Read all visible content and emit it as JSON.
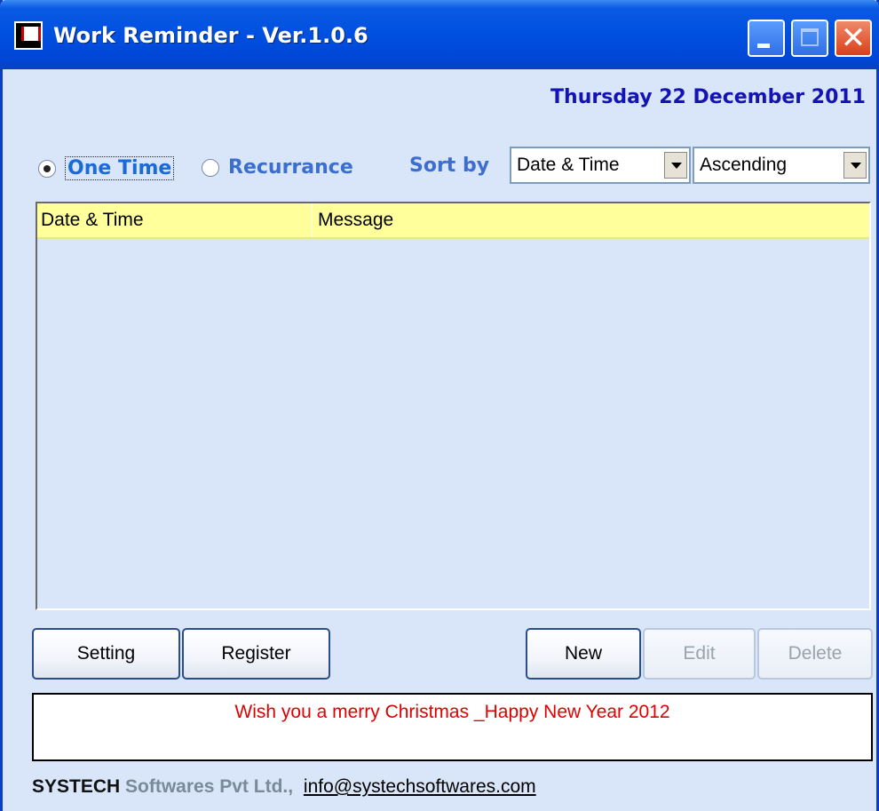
{
  "window": {
    "title": "Work Reminder - Ver.1.0.6"
  },
  "header": {
    "date": "Thursday 22 December 2011"
  },
  "filters": {
    "one_time_label": "One Time",
    "recurrance_label": "Recurrance",
    "selected": "One Time",
    "sort_by_label": "Sort by",
    "sort_field_value": "Date & Time",
    "sort_order_value": "Ascending"
  },
  "list": {
    "columns": [
      "Date & Time",
      "Message"
    ],
    "rows": []
  },
  "buttons": {
    "setting": "Setting",
    "register": "Register",
    "new": "New",
    "edit": "Edit",
    "delete": "Delete"
  },
  "message": "Wish you a merry Christmas _Happy New Year 2012",
  "footer": {
    "company_bold": "SYSTECH",
    "company_rest": "Softwares Pvt Ltd.,",
    "email": "info@systechsoftwares.com"
  },
  "colors": {
    "title_bar": "#0050e0",
    "window_bg": "#d9e5f8",
    "header_row": "#ffff9c",
    "date_text": "#1414b4",
    "message_text": "#e00000"
  }
}
